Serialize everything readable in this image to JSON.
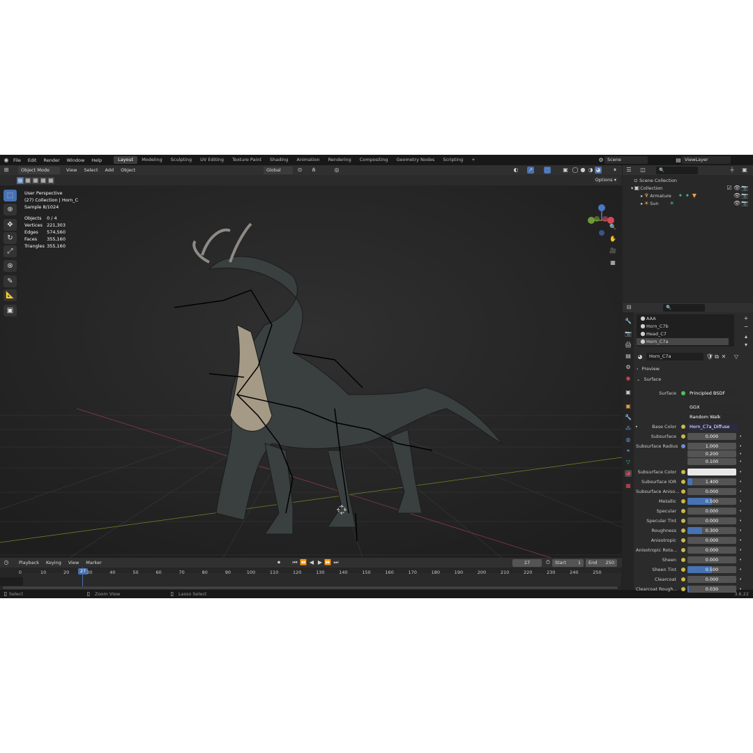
{
  "menu": {
    "items": [
      "File",
      "Edit",
      "Render",
      "Window",
      "Help"
    ]
  },
  "workspaces": [
    "Layout",
    "Modeling",
    "Sculpting",
    "UV Editing",
    "Texture Paint",
    "Shading",
    "Animation",
    "Rendering",
    "Compositing",
    "Geometry Nodes",
    "Scripting"
  ],
  "active_workspace": "Layout",
  "add_workspace": "+",
  "scene": {
    "label": "Scene",
    "view_layer": "ViewLayer"
  },
  "viewport_header": {
    "mode": "Object Mode",
    "menus": [
      "View",
      "Select",
      "Add",
      "Object"
    ],
    "orientation": "Global",
    "options": "Options"
  },
  "viewport_info": {
    "perspective": "User Perspective",
    "collection": "(27) Collection | Horn_C",
    "sample": "Sample 8/1024",
    "stats": [
      {
        "label": "Objects",
        "value": "0 / 4"
      },
      {
        "label": "Vertices",
        "value": "221,303"
      },
      {
        "label": "Edges",
        "value": "574,560"
      },
      {
        "label": "Faces",
        "value": "355,160"
      },
      {
        "label": "Triangles",
        "value": "355,160"
      }
    ]
  },
  "outliner": {
    "root": "Scene Collection",
    "collection": "Collection",
    "items": [
      "Armature",
      "Sun"
    ]
  },
  "materials": {
    "slots": [
      "AAA",
      "Horn_C7b",
      "Head_C7",
      "Horn_C7a"
    ],
    "selected": "Horn_C7a",
    "material_name": "Horn_C7a"
  },
  "properties": {
    "preview": "Preview",
    "surface_panel": "Surface",
    "surface_label": "Surface",
    "surface_value": "Principled BSDF",
    "distribution": "GGX",
    "subsurface_method": "Random Walk",
    "base_color_label": "Base Color",
    "base_color_value": "Horn_C7a_Diffuse",
    "rows": [
      {
        "label": "Subsurface",
        "value": "0.000",
        "fill": 0
      },
      {
        "label": "Subsurface Radius",
        "value": "1.000",
        "fill": 0
      },
      {
        "label": "",
        "value": "0.200",
        "fill": 0
      },
      {
        "label": "",
        "value": "0.100",
        "fill": 0
      },
      {
        "label": "Subsurface Color",
        "value": "",
        "fill": 0
      },
      {
        "label": "Subsurface IOR",
        "value": "1.400",
        "fill": 0.1
      },
      {
        "label": "Subsurface Aniso...",
        "value": "0.000",
        "fill": 0
      },
      {
        "label": "Metallic",
        "value": "0.500",
        "fill": 0.5
      },
      {
        "label": "Specular",
        "value": "0.000",
        "fill": 0
      },
      {
        "label": "Specular Tint",
        "value": "0.000",
        "fill": 0
      },
      {
        "label": "Roughness",
        "value": "0.300",
        "fill": 0.3
      },
      {
        "label": "Anisotropic",
        "value": "0.000",
        "fill": 0
      },
      {
        "label": "Anisotropic Rota...",
        "value": "0.000",
        "fill": 0
      },
      {
        "label": "Sheen",
        "value": "0.000",
        "fill": 0
      },
      {
        "label": "Sheen Tint",
        "value": "0.500",
        "fill": 0.5
      },
      {
        "label": "Clearcoat",
        "value": "0.000",
        "fill": 0
      },
      {
        "label": "Clearcoat Rough...",
        "value": "0.030",
        "fill": 0.03
      }
    ],
    "colors": {
      "subsurface_color": "#e8e8e8",
      "accent": "#4772b3"
    }
  },
  "timeline": {
    "menus": [
      "Playback",
      "Keying",
      "View",
      "Marker"
    ],
    "current_frame": "27",
    "start_label": "Start",
    "start": "1",
    "end_label": "End",
    "end": "250",
    "ticks": [
      "0",
      "10",
      "20",
      "30",
      "40",
      "50",
      "60",
      "70",
      "80",
      "90",
      "100",
      "110",
      "120",
      "130",
      "140",
      "150",
      "160",
      "170",
      "180",
      "190",
      "200",
      "210",
      "220",
      "230",
      "240",
      "250"
    ]
  },
  "status": {
    "select": "Select",
    "zoom": "Zoom View",
    "lasso": "Lasso Select",
    "version": "3.6.22"
  }
}
